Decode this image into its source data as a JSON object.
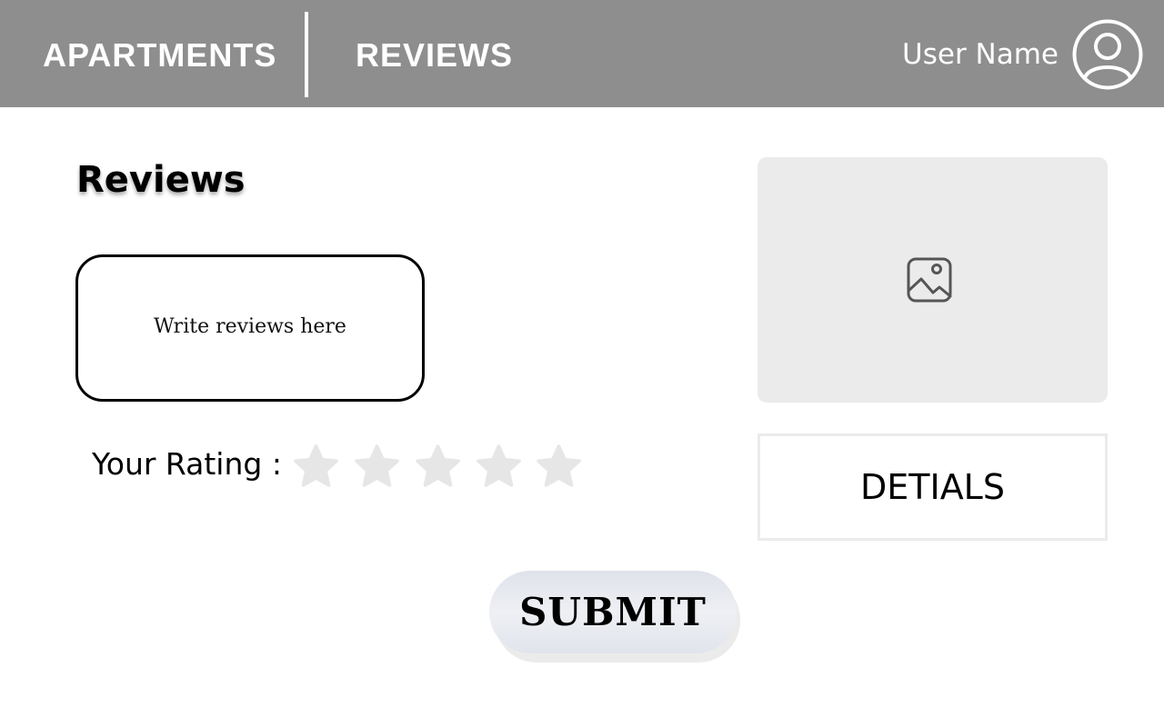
{
  "header": {
    "nav": [
      {
        "label": "APARTMENTS"
      },
      {
        "label": "REVIEWS"
      }
    ],
    "user_name": "User Name",
    "avatar_icon": "user-avatar-icon"
  },
  "main": {
    "title": "Reviews",
    "review_input": {
      "placeholder": "Write reviews here",
      "value": ""
    },
    "rating": {
      "label": "Your Rating :",
      "value": 0,
      "max": 5,
      "star_color_empty": "#e6e6e6"
    },
    "image_icon": "image-icon",
    "details_label": "DETIALS",
    "submit_label": "SUBMIT"
  },
  "colors": {
    "header_bg": "#8e8e8e",
    "panel_bg": "#ebebeb"
  }
}
